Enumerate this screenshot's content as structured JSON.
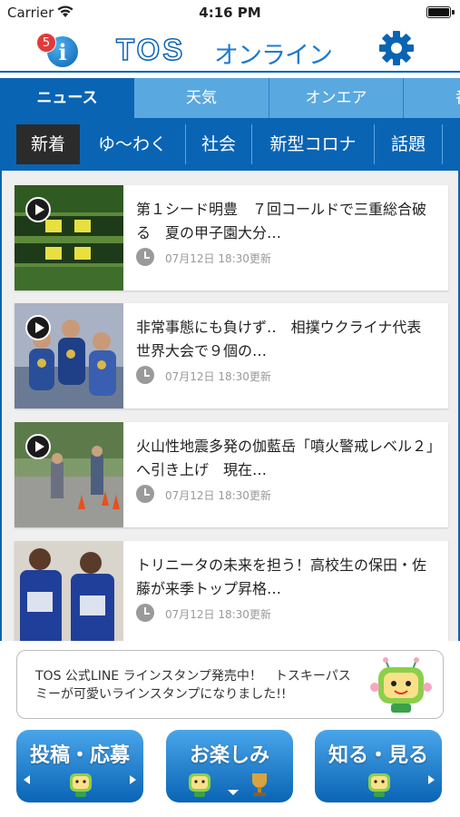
{
  "status_bar": {
    "carrier": "Carrier",
    "time": "4:16 PM"
  },
  "header": {
    "badge_count": "5",
    "info_letter": "i",
    "logo_latin": "TOS",
    "logo_kana": "オンライン",
    "brand_color": "#0a64b4"
  },
  "main_tabs": [
    {
      "label": "ニュース",
      "active": true
    },
    {
      "label": "天気",
      "active": false
    },
    {
      "label": "オンエア",
      "active": false
    },
    {
      "label": "番",
      "active": false
    }
  ],
  "sub_tabs": [
    {
      "label": "新着",
      "active": true
    },
    {
      "label": "ゆ〜わく",
      "active": false
    },
    {
      "label": "社会",
      "active": false
    },
    {
      "label": "新型コロナ",
      "active": false
    },
    {
      "label": "話題",
      "active": false
    }
  ],
  "news": [
    {
      "title": "第１シード明豊　７回コールドで三重総合破る　夏の甲子園大分…",
      "updated": "07月12日 18:30更新",
      "has_video": true
    },
    {
      "title": "非常事態にも負けず‥　相撲ウクライナ代表　世界大会で９個の…",
      "updated": "07月12日 18:30更新",
      "has_video": true
    },
    {
      "title": "火山性地震多発の伽藍岳「噴火警戒レベル２」へ引き上げ　現在…",
      "updated": "07月12日 18:30更新",
      "has_video": true
    },
    {
      "title": "トリニータの未来を担う！高校生の保田・佐藤が来季トップ昇格…",
      "updated": "07月12日 18:30更新",
      "has_video": false
    }
  ],
  "banner": {
    "text": "TOS 公式LINE ラインスタンプ発売中！　トスキーパスミーが可愛いラインスタンプになりました!!"
  },
  "bottom_buttons": [
    {
      "label": "投稿・応募"
    },
    {
      "label": "お楽しみ"
    },
    {
      "label": "知る・見る"
    }
  ]
}
